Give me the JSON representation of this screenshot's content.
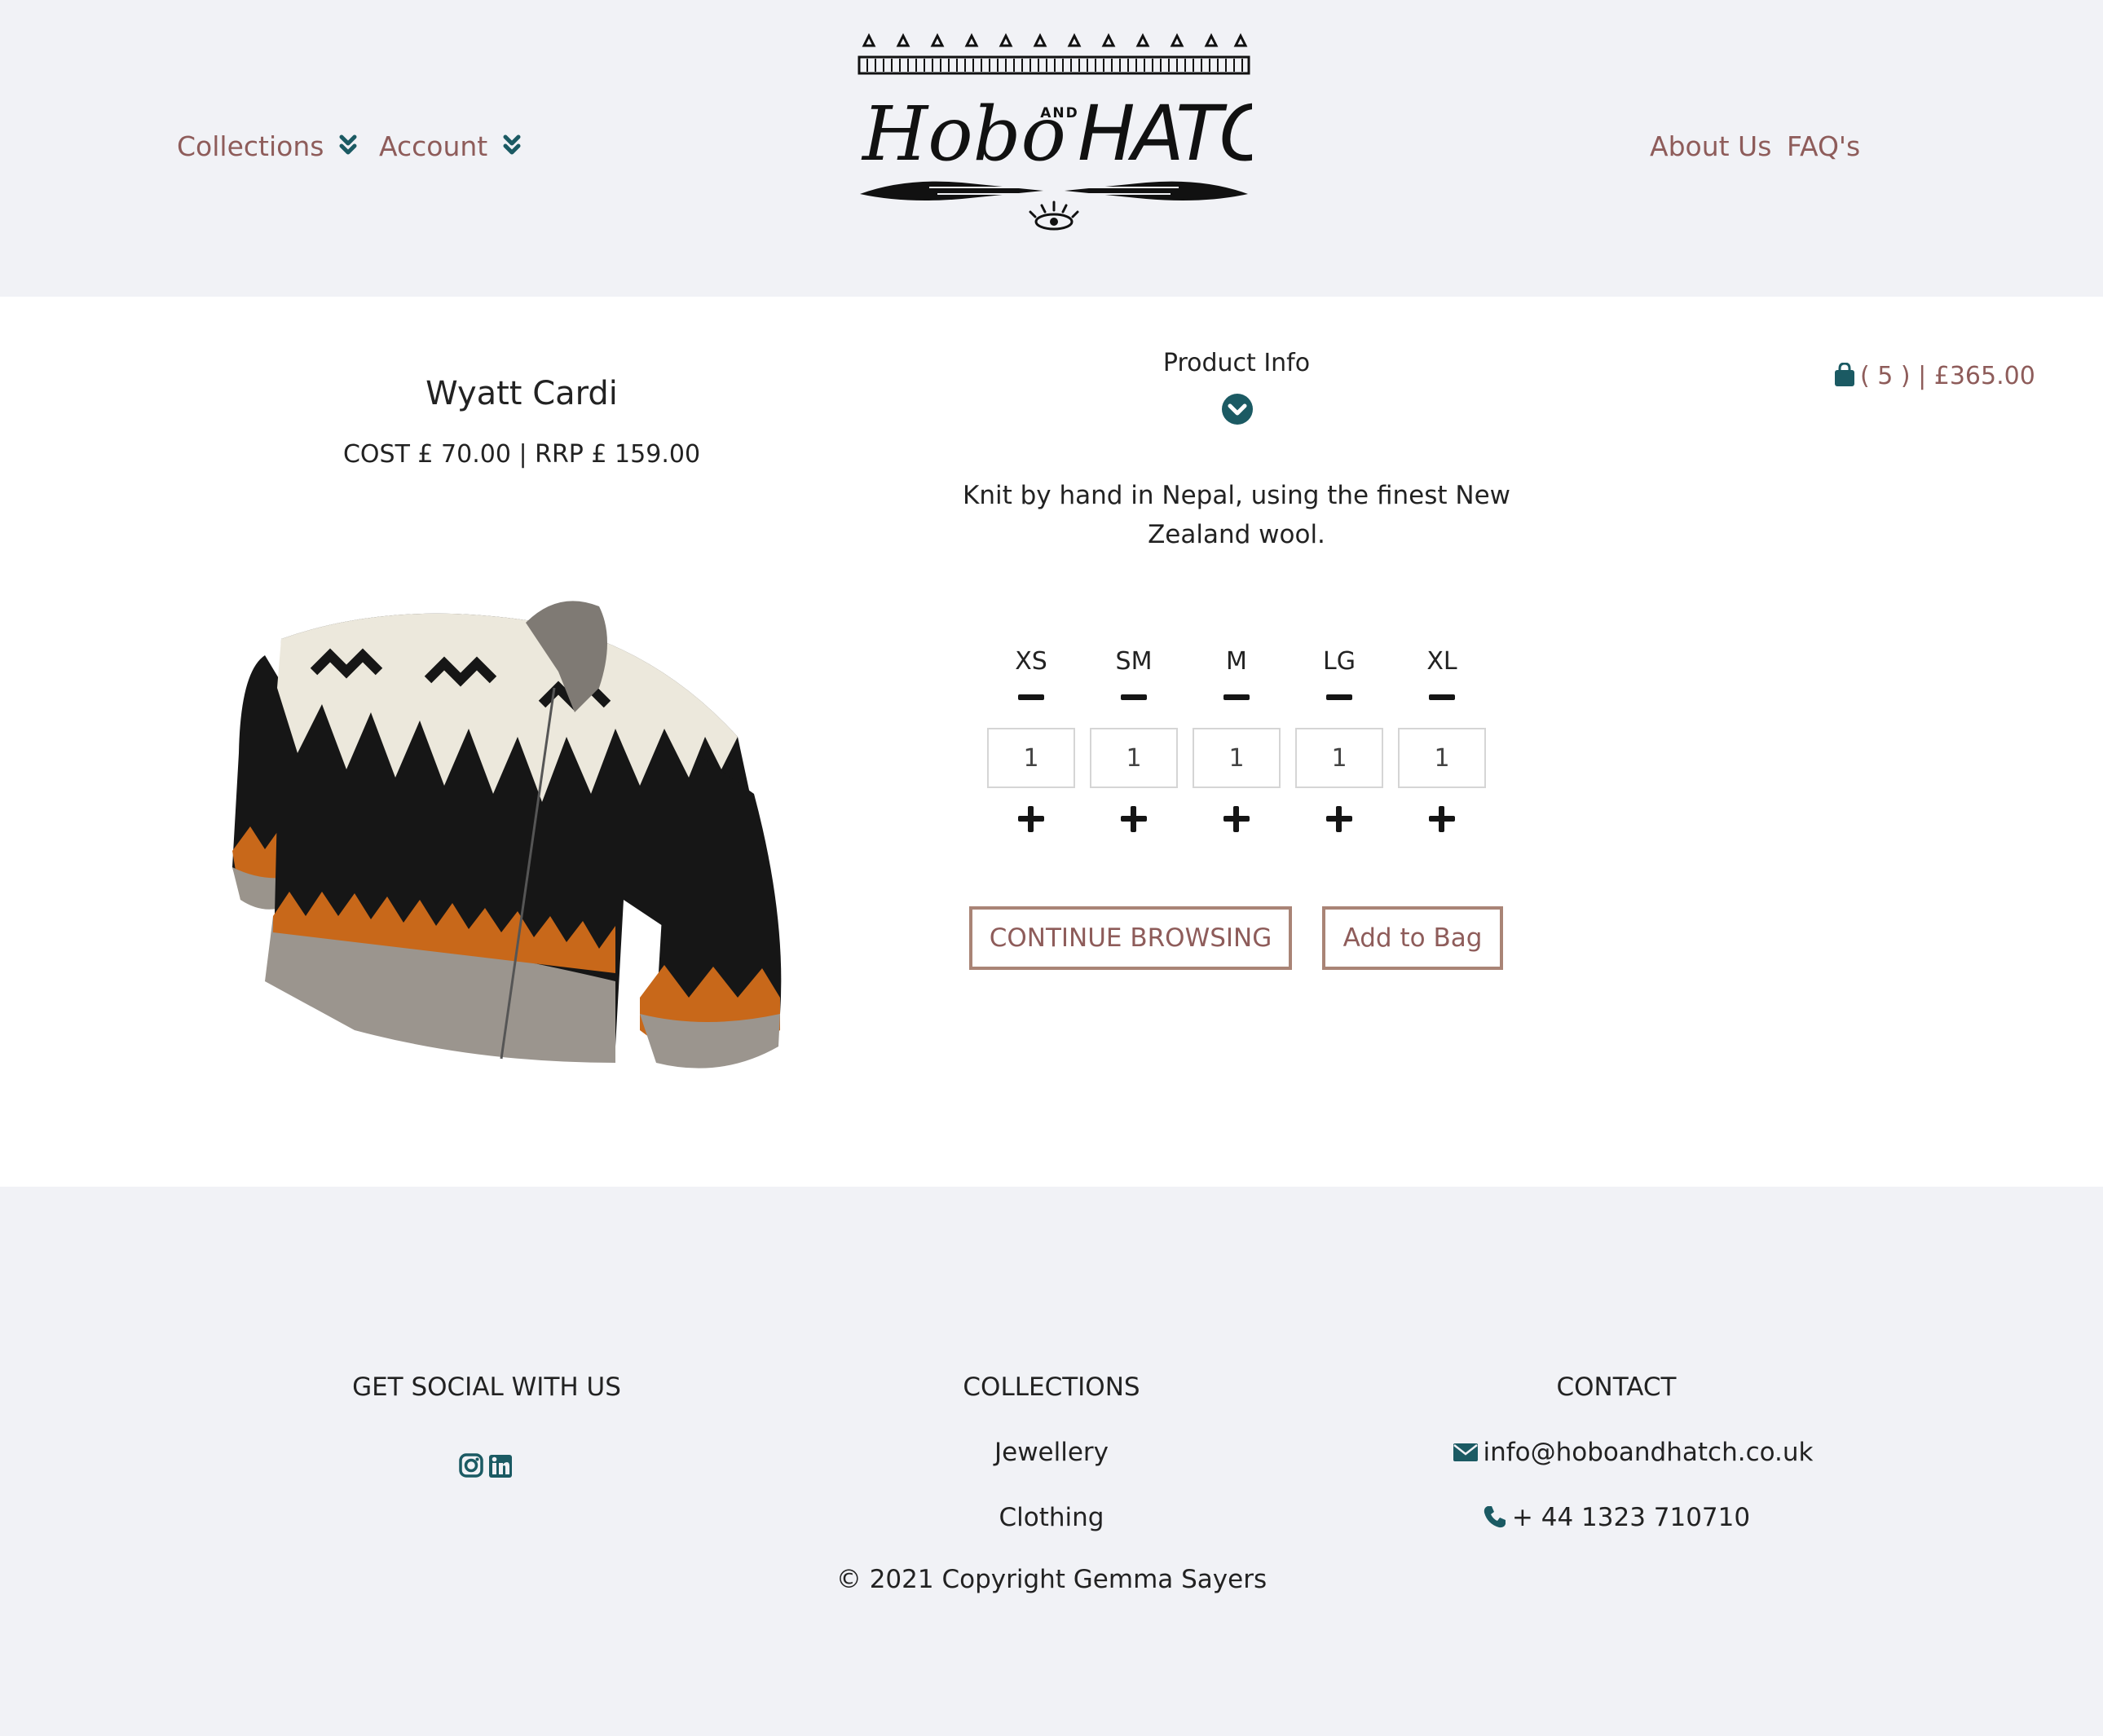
{
  "header": {
    "nav_left": [
      {
        "label": "Collections"
      },
      {
        "label": "Account"
      }
    ],
    "nav_right": [
      {
        "label": "About Us"
      },
      {
        "label": "FAQ's"
      }
    ],
    "logo": {
      "text_left": "Hobo",
      "text_mid": "AND",
      "text_right": "HATCH"
    }
  },
  "product": {
    "title": "Wyatt Cardi",
    "price": "COST £ 70.00 | RRP £ 159.00",
    "info_title": "Product Info",
    "description": "Knit by hand in Nepal, using the finest New Zealand wool.",
    "sizes": [
      {
        "label": "XS",
        "qty": "1"
      },
      {
        "label": "SM",
        "qty": "1"
      },
      {
        "label": "M",
        "qty": "1"
      },
      {
        "label": "LG",
        "qty": "1"
      },
      {
        "label": "XL",
        "qty": "1"
      }
    ],
    "continue_label": "CONTINUE BROWSING",
    "add_label": "Add to Bag"
  },
  "cart": {
    "text": "( 5 ) | £365.00"
  },
  "footer": {
    "social_heading": "GET SOCIAL WITH US",
    "collections_heading": "COLLECTIONS",
    "collections_links": [
      "Jewellery",
      "Clothing"
    ],
    "contact_heading": "CONTACT",
    "email": "info@hoboandhatch.co.uk",
    "phone": "+ 44 1323 710710",
    "copyright": "© 2021 Copyright Gemma Sayers"
  },
  "colors": {
    "brand_text": "#8e5c5a",
    "teal_accent": "#1b5a63",
    "button_border": "#a98476",
    "page_bg": "#f1f2f6"
  }
}
